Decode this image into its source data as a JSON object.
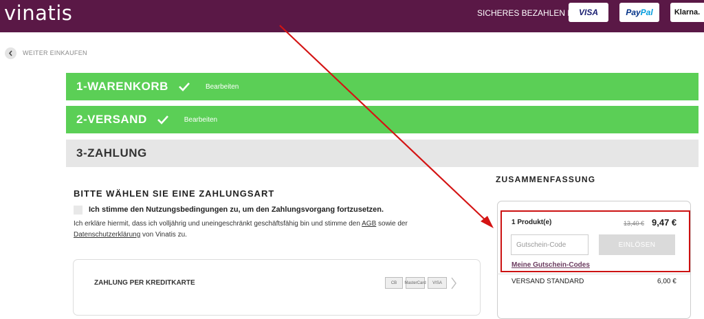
{
  "header": {
    "logo": "vinatis",
    "secure_label": "SICHERES BEZAHLEN MIT:",
    "payment_badges": [
      "VISA",
      "Pay",
      "Pal",
      "Klarna."
    ]
  },
  "nav": {
    "back_label": "WEITER EINKAUFEN"
  },
  "steps": [
    {
      "title": "1-WARENKORB",
      "edit": "Bearbeiten",
      "status": "done"
    },
    {
      "title": "2-VERSAND",
      "edit": "Bearbeiten",
      "status": "done"
    },
    {
      "title": "3-ZAHLUNG",
      "status": "active"
    }
  ],
  "payment": {
    "section_title": "BITTE WÄHLEN SIE EINE ZAHLUNGSART",
    "agree_text": "Ich stimme den Nutzungsbedingungen zu, um den Zahlungsvorgang fortzusetzen.",
    "legal_before": "Ich erkläre hiermit, dass ich volljährig und uneingeschränkt geschäftsfähig bin und stimme den ",
    "legal_agb": "AGB",
    "legal_middle": " sowie der ",
    "legal_privacy": "Datenschutzerklärung",
    "legal_after": " von Vinatis zu.",
    "method_label": "ZAHLUNG PER KREDITKARTE",
    "card_logos": [
      "CB",
      "MasterCard",
      "VISA"
    ]
  },
  "summary": {
    "title": "ZUSAMMENFASSUNG",
    "product_count": "1 Produkt(e)",
    "old_price": "13,40 €",
    "price": "9,47 €",
    "coupon_placeholder": "Gutschein-Code",
    "redeem_label": "EINLÖSEN",
    "my_codes": "Meine Gutschein-Codes",
    "shipping_label": "VERSAND STANDARD",
    "shipping_price": "6,00 €"
  },
  "colors": {
    "header_bg": "#5a1846",
    "step_done": "#5bcf56",
    "step_active": "#e6e6e6",
    "highlight": "#cc1111"
  }
}
